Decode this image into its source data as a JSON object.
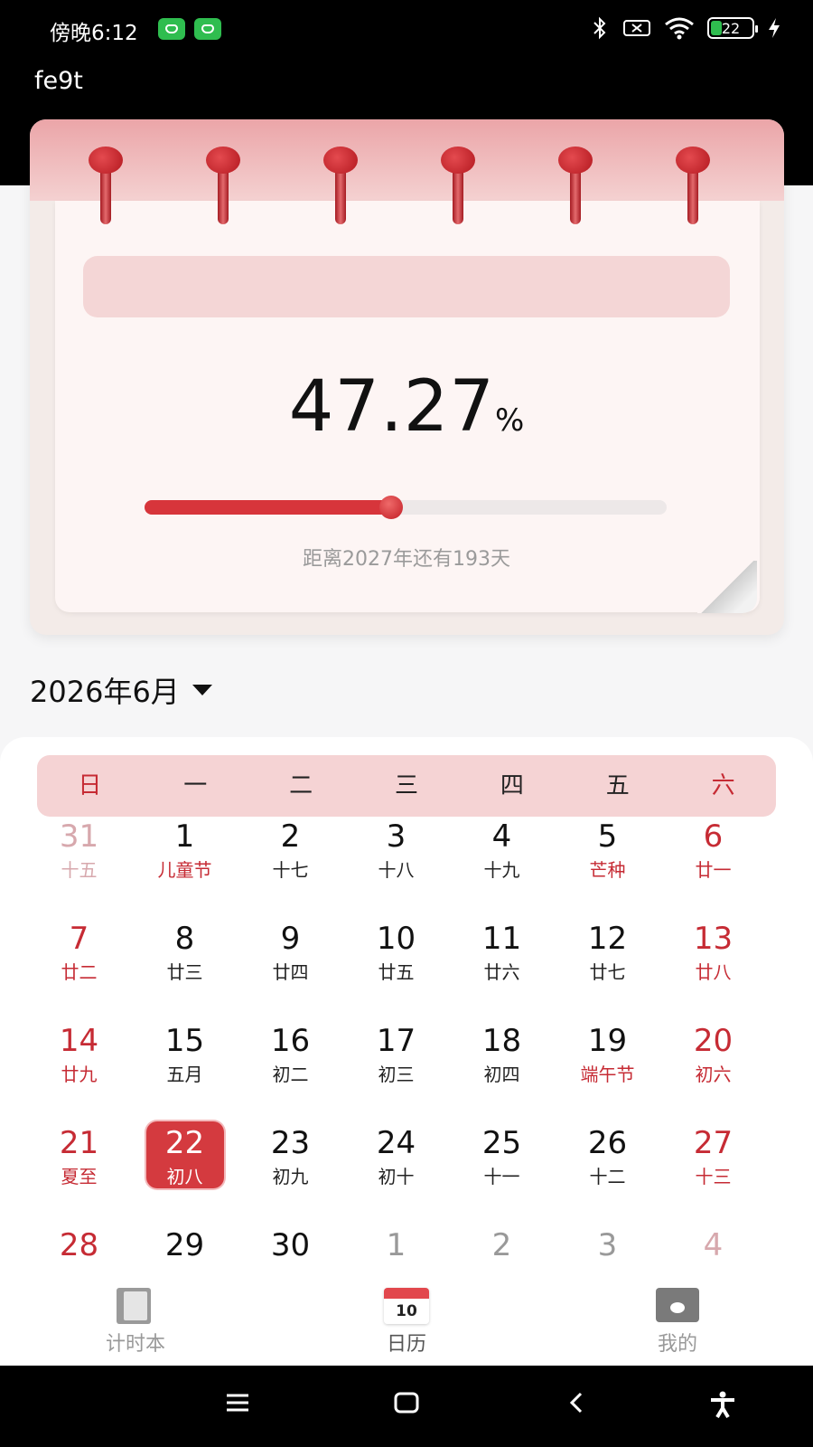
{
  "status_bar": {
    "time": "傍晚6:12",
    "battery": "22"
  },
  "app": {
    "title": "fe9t"
  },
  "progress_card": {
    "percent_value": "47.27",
    "percent_symbol": "%",
    "progress_fraction": 0.4727,
    "countdown_text": "距离2027年还有193天"
  },
  "month_selector": {
    "label": "2026年6月"
  },
  "calendar": {
    "weekdays": [
      "日",
      "一",
      "二",
      "三",
      "四",
      "五",
      "六"
    ],
    "rows": [
      [
        {
          "n": "31",
          "l": "十五"
        },
        {
          "n": "1",
          "l": "儿童节"
        },
        {
          "n": "2",
          "l": "十七"
        },
        {
          "n": "3",
          "l": "十八"
        },
        {
          "n": "4",
          "l": "十九"
        },
        {
          "n": "5",
          "l": "芒种"
        },
        {
          "n": "6",
          "l": "廿一"
        }
      ],
      [
        {
          "n": "7",
          "l": "廿二"
        },
        {
          "n": "8",
          "l": "廿三"
        },
        {
          "n": "9",
          "l": "廿四"
        },
        {
          "n": "10",
          "l": "廿五"
        },
        {
          "n": "11",
          "l": "廿六"
        },
        {
          "n": "12",
          "l": "廿七"
        },
        {
          "n": "13",
          "l": "廿八"
        }
      ],
      [
        {
          "n": "14",
          "l": "廿九"
        },
        {
          "n": "15",
          "l": "五月"
        },
        {
          "n": "16",
          "l": "初二"
        },
        {
          "n": "17",
          "l": "初三"
        },
        {
          "n": "18",
          "l": "初四"
        },
        {
          "n": "19",
          "l": "端午节"
        },
        {
          "n": "20",
          "l": "初六"
        }
      ],
      [
        {
          "n": "21",
          "l": "夏至"
        },
        {
          "n": "22",
          "l": "初八"
        },
        {
          "n": "23",
          "l": "初九"
        },
        {
          "n": "24",
          "l": "初十"
        },
        {
          "n": "25",
          "l": "十一"
        },
        {
          "n": "26",
          "l": "十二"
        },
        {
          "n": "27",
          "l": "十三"
        }
      ],
      [
        {
          "n": "28",
          "l": ""
        },
        {
          "n": "29",
          "l": ""
        },
        {
          "n": "30",
          "l": ""
        },
        {
          "n": "1",
          "l": ""
        },
        {
          "n": "2",
          "l": ""
        },
        {
          "n": "3",
          "l": ""
        },
        {
          "n": "4",
          "l": ""
        }
      ]
    ]
  },
  "bottom_nav": {
    "items": [
      {
        "label": "计时本"
      },
      {
        "label": "日历",
        "icon_number": "10"
      },
      {
        "label": "我的"
      }
    ]
  },
  "colors": {
    "accent": "#d43a3f",
    "weekend": "#c62b34",
    "header_pink": "#f5d3d4"
  }
}
